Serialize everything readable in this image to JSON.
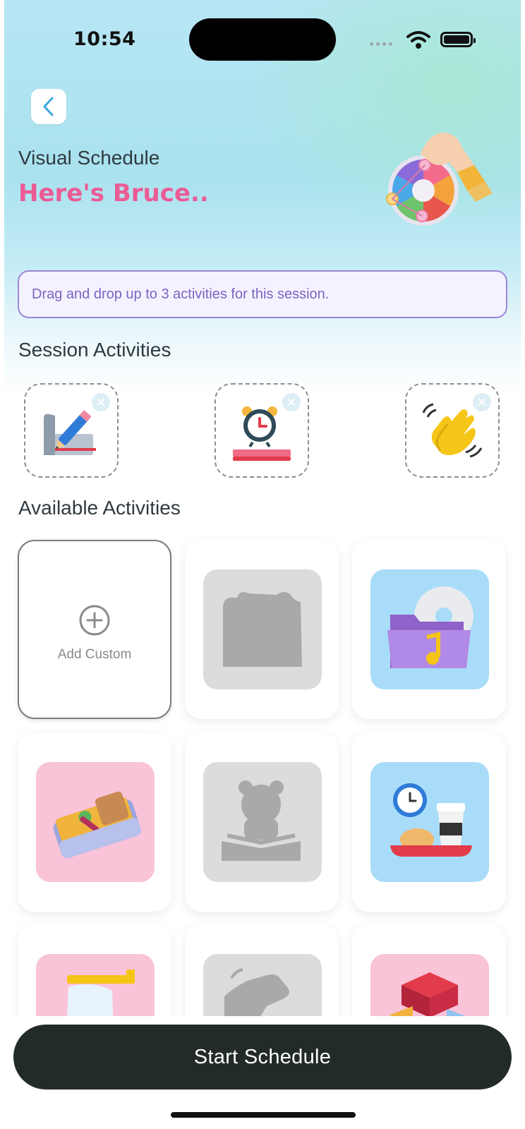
{
  "status_bar": {
    "time": "10:54"
  },
  "header": {
    "subtitle": "Visual Schedule",
    "title": "Here's Bruce.."
  },
  "info_box": {
    "text": "Drag and drop up to 3 activities for this session."
  },
  "sections": {
    "session": "Session Activities",
    "available": "Available Activities"
  },
  "session_slots": [
    "writing-icon",
    "reading-alarm-icon",
    "clapping-hands-icon"
  ],
  "available": {
    "add_custom_label": "Add Custom",
    "items": [
      "placeholder-activity-icon",
      "music-folder-icon",
      "lunch-box-icon",
      "reading-placeholder-icon",
      "snack-time-icon",
      "toothbrush-icon",
      "clapping-placeholder-icon",
      "blocks-icon"
    ]
  },
  "colors": {
    "accent_pink": "#ec5b95",
    "info_purple": "#7b64c2",
    "button_dark": "#222b2a"
  },
  "start_button": {
    "label": "Start Schedule"
  }
}
